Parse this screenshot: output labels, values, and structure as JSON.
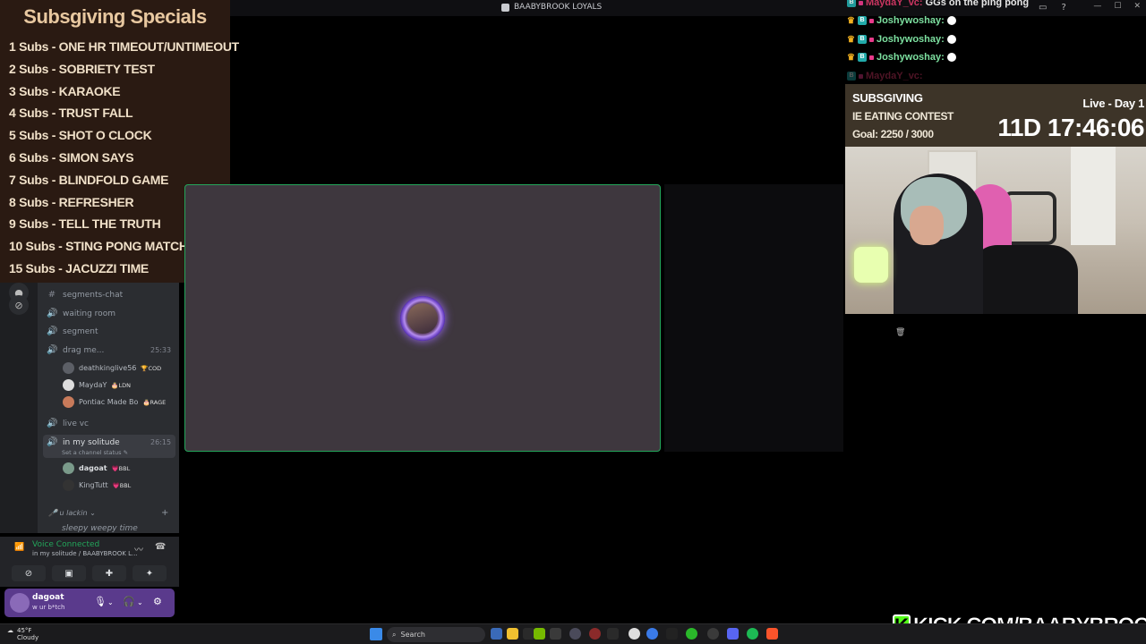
{
  "window": {
    "title": "BAABYBROOK LOYALS",
    "controls": [
      "—",
      "☐",
      "✕"
    ]
  },
  "specials": {
    "title": "Subsgiving Specials",
    "items": [
      "1 Subs - ONE HR TIMEOUT/UNTIMEOUT",
      "2 Subs - SOBRIETY TEST",
      "3 Subs - KARAOKE",
      "4 Subs - TRUST FALL",
      "5 Subs - SHOT O CLOCK",
      "6 Subs - SIMON SAYS",
      "7 Subs - BLINDFOLD GAME",
      "8 Subs - REFRESHER",
      "9 Subs - TELL THE TRUTH",
      "10 Subs - STING PONG MATCH",
      "15 Subs - JACUZZI TIME"
    ]
  },
  "channels": {
    "items": [
      {
        "name": "segments-chat",
        "symbol": "#"
      },
      {
        "name": "waiting room",
        "symbol": "🔊"
      },
      {
        "name": "segment",
        "symbol": "🔊"
      },
      {
        "name": "drag me...",
        "symbol": "🔊",
        "time": "25:33"
      },
      {
        "name": "live vc",
        "symbol": "🔊"
      },
      {
        "name": "in my solitude",
        "symbol": "🔊",
        "time": "26:15",
        "status": "Set a channel status ✎"
      }
    ],
    "drag_users": [
      {
        "name": "deathkinglive56",
        "tag": "🏆COD"
      },
      {
        "name": "MaydaY",
        "tag": "🎂LDN"
      },
      {
        "name": "Pontiac Made Bo",
        "tag": "🎂RAGE"
      }
    ],
    "solitude_users": [
      {
        "name": "dagoat",
        "tag": "💗BBL"
      },
      {
        "name": "KingTutt",
        "tag": "💗BBL"
      }
    ],
    "category": "🎤 u lackin ⌄",
    "category_add": "+",
    "last_channel": "sleepy weepy time"
  },
  "voice": {
    "title": "Voice Connected",
    "subtitle": "in my solitude / BAABYBROOK L..."
  },
  "user": {
    "name": "dagoat",
    "status": "w ur b*tch"
  },
  "chat": [
    {
      "nick": "MaydaY_vc:",
      "msg": "GGs on the ping pong"
    },
    {
      "nick": "Joshywoshay:",
      "msg": ""
    },
    {
      "nick": "Joshywoshay:",
      "msg": ""
    },
    {
      "nick": "Joshywoshay:",
      "msg": ""
    },
    {
      "nick": "MaydaY_vc:",
      "msg": ""
    }
  ],
  "widget": {
    "title": "SUBSGIVING",
    "contest": "IE EATING CONTEST",
    "goal": "Goal: 2250 / 3000",
    "live": "Live - Day 1",
    "timer": "11D  17:46:06"
  },
  "kick": {
    "logo": "K",
    "url": "KICK.COM/BAABYBROOK"
  },
  "taskbar": {
    "temp": "45°F",
    "weather": "Cloudy",
    "search": "Search"
  },
  "colors": {
    "speaking_border": "#23a55a",
    "tile_bg": "#3e373e",
    "kick_green": "#53fc18",
    "user_bar": "#5a3a8c"
  }
}
